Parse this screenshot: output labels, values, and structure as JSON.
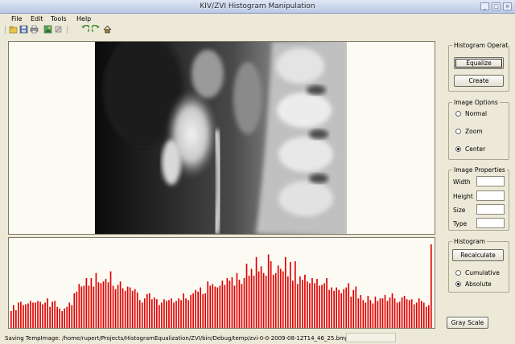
{
  "window": {
    "title": "KIV/ZVI Histogram Manipulation"
  },
  "menu": [
    "File",
    "Edit",
    "Tools",
    "Help"
  ],
  "toolbar": [
    "new-icon",
    "save-icon",
    "print-icon",
    "image-icon",
    "crop-icon",
    "undo-icon",
    "redo-icon",
    "home-icon"
  ],
  "histogram_ops": {
    "title": "Histogram Operations",
    "equalize": "Equalize",
    "create": "Create"
  },
  "image_options": {
    "title": "Image Options",
    "normal": "Normal",
    "zoom": "Zoom",
    "center": "Center",
    "selected": "Center"
  },
  "image_properties": {
    "title": "Image Properties",
    "width_label": "Width",
    "width_value": "",
    "height_label": "Height",
    "height_value": "",
    "size_label": "Size",
    "size_value": "",
    "type_label": "Type",
    "type_value": ""
  },
  "histogram_group": {
    "title": "Histogram",
    "recalculate": "Recalculate",
    "cumulative": "Cumulative",
    "absolute": "Absolute",
    "selected": "Absolute"
  },
  "gray_scale": "Gray Scale",
  "status": "Saving TempImage: /home/rupert/Projects/HistogramEqualization/ZVI/bin/Debug/temp/zvi-0-0-2009-08-12T14_46_25.bmp",
  "colors": {
    "histogram_bar": "#e00000",
    "panel_bg": "#fbfaf3",
    "window_bg": "#ece9d8"
  },
  "histogram_levels": [
    20,
    27,
    21,
    30,
    31,
    27,
    28,
    29,
    32,
    30,
    30,
    32,
    31,
    28,
    30,
    35,
    25,
    31,
    32,
    25,
    23,
    20,
    23,
    25,
    30,
    27,
    41,
    43,
    52,
    49,
    50,
    59,
    50,
    59,
    49,
    65,
    54,
    53,
    55,
    58,
    54,
    67,
    50,
    46,
    51,
    55,
    47,
    44,
    49,
    48,
    44,
    46,
    42,
    33,
    30,
    35,
    40,
    41,
    34,
    36,
    34,
    27,
    30,
    34,
    32,
    33,
    35,
    30,
    32,
    35,
    33,
    41,
    35,
    33,
    39,
    41,
    45,
    43,
    48,
    40,
    41,
    55,
    50,
    52,
    49,
    48,
    50,
    56,
    51,
    59,
    56,
    60,
    50,
    65,
    57,
    52,
    59,
    76,
    62,
    70,
    62,
    84,
    67,
    73,
    65,
    62,
    87,
    79,
    63,
    65,
    74,
    70,
    67,
    84,
    61,
    78,
    56,
    79,
    52,
    61,
    57,
    63,
    55,
    53,
    59,
    53,
    58,
    50,
    51,
    53,
    59,
    45,
    48,
    44,
    48,
    45,
    41,
    46,
    48,
    53,
    37,
    45,
    49,
    35,
    39,
    33,
    30,
    38,
    33,
    29,
    37,
    32,
    35,
    35,
    39,
    32,
    36,
    41,
    35,
    30,
    31,
    36,
    38,
    34,
    33,
    34,
    28,
    30,
    35,
    32,
    30,
    25,
    27,
    99
  ]
}
